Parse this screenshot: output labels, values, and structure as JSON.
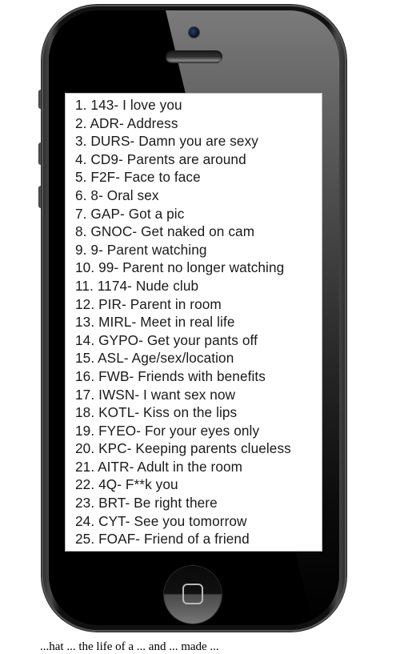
{
  "screen": {
    "items": [
      "1. 143- I love you",
      "2. ADR- Address",
      "3. DURS- Damn you are sexy",
      "4. CD9- Parents are around",
      "5. F2F- Face to face",
      "6. 8- Oral sex",
      "7. GAP- Got a pic",
      "8. GNOC- Get naked on cam",
      "9. 9- Parent watching",
      "10. 99- Parent no longer watching",
      "11. 1174- Nude club",
      "12. PIR- Parent in room",
      "13. MIRL- Meet in real life",
      "14. GYPO- Get your pants off",
      "15. ASL- Age/sex/location",
      "16. FWB- Friends with benefits",
      "17. IWSN- I want sex now",
      "18. KOTL- Kiss on the lips",
      "19. FYEO- For your eyes only",
      "20. KPC- Keeping parents clueless",
      "21. AITR- Adult in the room",
      "22. 4Q- F**k you",
      "23. BRT- Be right there",
      "24. CYT- See you tomorrow",
      "25. FOAF- Friend of a friend"
    ]
  },
  "caption": "...hat ... the life of a ... and ... made ...",
  "colors": {
    "phone_body": "#000000",
    "glare": "#6f6f6f",
    "screen_bg": "#ffffff",
    "text": "#1a1a1a"
  }
}
